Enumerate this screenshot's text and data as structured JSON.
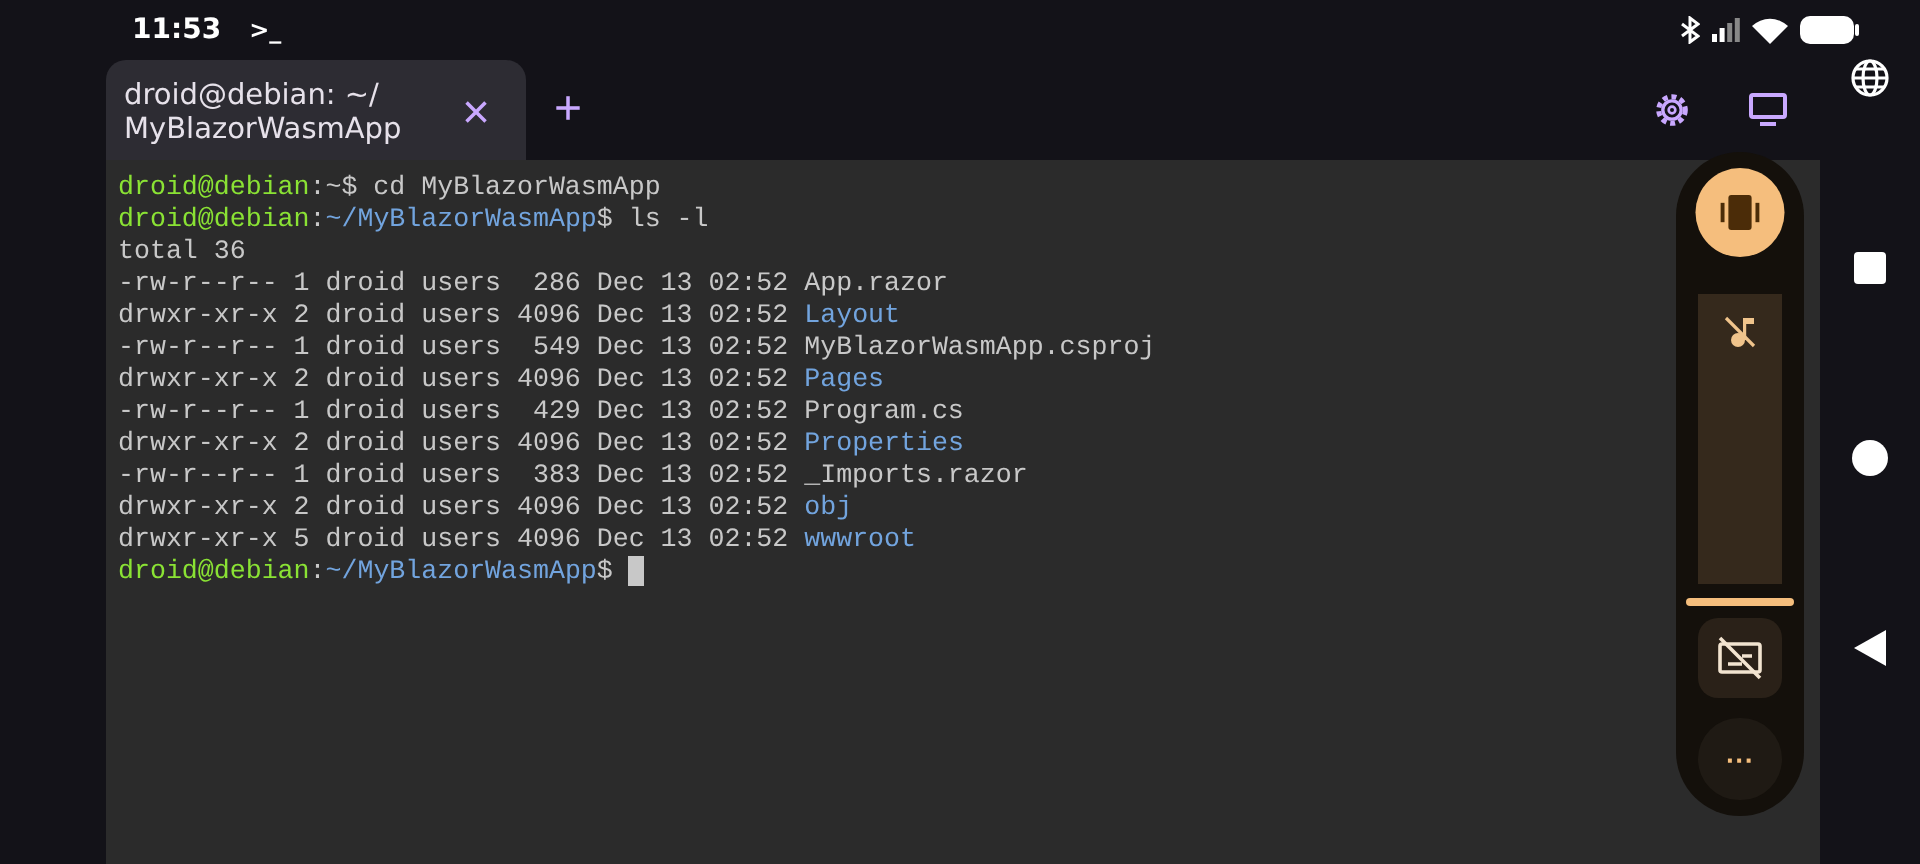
{
  "status_bar": {
    "time": "11:53",
    "terminal_glyph": ">_"
  },
  "tabs": [
    {
      "label": "droid@debian: ~/\nMyBlazorWasmApp",
      "selected": true,
      "close": "×"
    }
  ],
  "new_tab": "+",
  "terminal": {
    "lines": [
      {
        "segments": [
          {
            "kind": "user",
            "text": "droid@debian"
          },
          {
            "kind": "plain",
            "text": ":~$ cd MyBlazorWasmApp"
          }
        ]
      },
      {
        "segments": [
          {
            "kind": "user",
            "text": "droid@debian"
          },
          {
            "kind": "plain",
            "text": ":"
          },
          {
            "kind": "path",
            "text": "~/MyBlazorWasmApp"
          },
          {
            "kind": "plain",
            "text": "$ ls -l"
          }
        ]
      },
      {
        "segments": [
          {
            "kind": "plain",
            "text": "total 36"
          }
        ]
      },
      {
        "segments": [
          {
            "kind": "plain",
            "text": "-rw-r--r-- 1 droid users  286 Dec 13 02:52 App.razor"
          }
        ]
      },
      {
        "segments": [
          {
            "kind": "plain",
            "text": "drwxr-xr-x 2 droid users 4096 Dec 13 02:52 "
          },
          {
            "kind": "path",
            "text": "Layout"
          }
        ]
      },
      {
        "segments": [
          {
            "kind": "plain",
            "text": "-rw-r--r-- 1 droid users  549 Dec 13 02:52 MyBlazorWasmApp.csproj"
          }
        ]
      },
      {
        "segments": [
          {
            "kind": "plain",
            "text": "drwxr-xr-x 2 droid users 4096 Dec 13 02:52 "
          },
          {
            "kind": "path",
            "text": "Pages"
          }
        ]
      },
      {
        "segments": [
          {
            "kind": "plain",
            "text": "-rw-r--r-- 1 droid users  429 Dec 13 02:52 Program.cs"
          }
        ]
      },
      {
        "segments": [
          {
            "kind": "plain",
            "text": "drwxr-xr-x 2 droid users 4096 Dec 13 02:52 "
          },
          {
            "kind": "path",
            "text": "Properties"
          }
        ]
      },
      {
        "segments": [
          {
            "kind": "plain",
            "text": "-rw-r--r-- 1 droid users  383 Dec 13 02:52 _Imports.razor"
          }
        ]
      },
      {
        "segments": [
          {
            "kind": "plain",
            "text": "drwxr-xr-x 2 droid users 4096 Dec 13 02:52 "
          },
          {
            "kind": "path",
            "text": "obj"
          }
        ]
      },
      {
        "segments": [
          {
            "kind": "plain",
            "text": "drwxr-xr-x 5 droid users 4096 Dec 13 02:52 "
          },
          {
            "kind": "path",
            "text": "wwwroot"
          }
        ]
      },
      {
        "segments": [
          {
            "kind": "user",
            "text": "droid@debian"
          },
          {
            "kind": "plain",
            "text": ":"
          },
          {
            "kind": "path",
            "text": "~/MyBlazorWasmApp"
          },
          {
            "kind": "plain",
            "text": "$ "
          }
        ],
        "cursor": true
      }
    ]
  },
  "volume_panel": {
    "level": 0,
    "more": "···"
  }
}
